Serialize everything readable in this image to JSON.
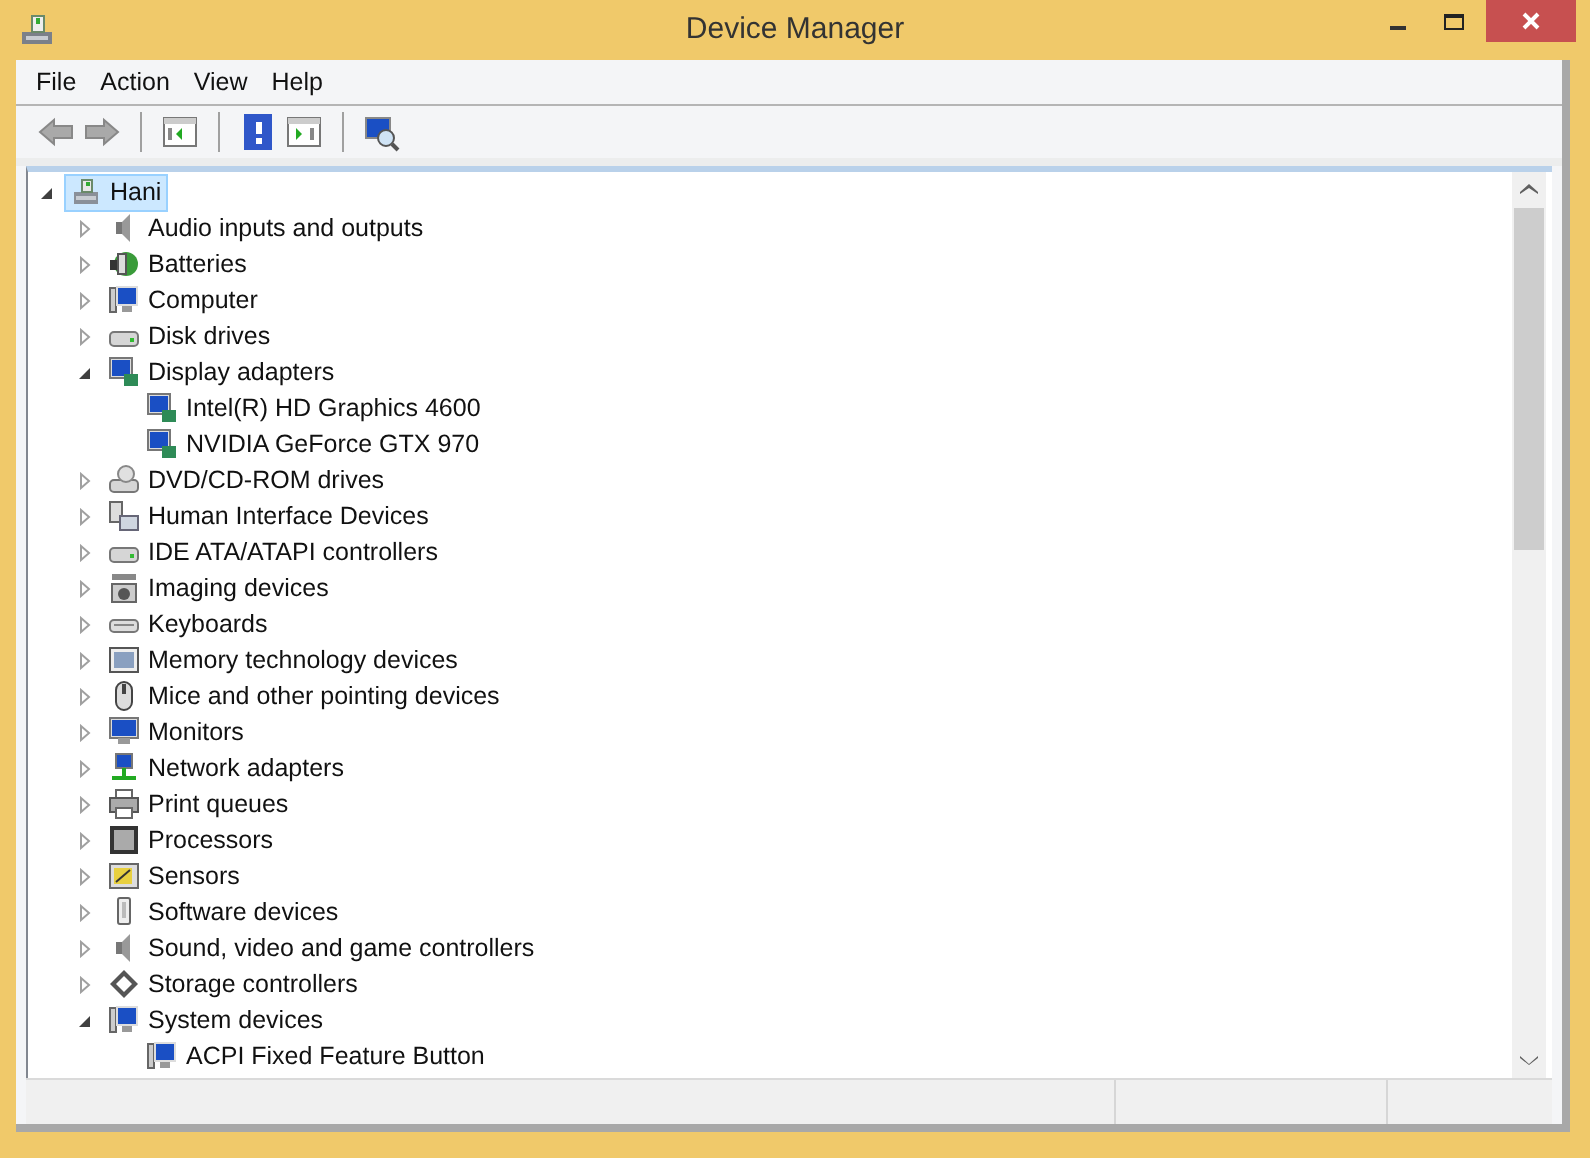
{
  "window": {
    "title": "Device Manager"
  },
  "menu": [
    "File",
    "Action",
    "View",
    "Help"
  ],
  "toolbar": [
    {
      "kind": "back"
    },
    {
      "kind": "forward"
    },
    {
      "kind": "sep"
    },
    {
      "kind": "tree"
    },
    {
      "kind": "sep"
    },
    {
      "kind": "help"
    },
    {
      "kind": "pane"
    },
    {
      "kind": "sep"
    },
    {
      "kind": "scan"
    }
  ],
  "tree": {
    "items": [
      {
        "label": "Hani",
        "kind": "host",
        "selected": true,
        "expanded": true,
        "children": [
          {
            "label": "Audio inputs and outputs",
            "kind": "speaker",
            "selected": false,
            "expanded": false
          },
          {
            "label": "Batteries",
            "kind": "battery",
            "selected": false,
            "expanded": false
          },
          {
            "label": "Computer",
            "kind": "computer",
            "selected": false,
            "expanded": false
          },
          {
            "label": "Disk drives",
            "kind": "drive",
            "selected": false,
            "expanded": false
          },
          {
            "label": "Display adapters",
            "kind": "adapter",
            "selected": false,
            "expanded": true,
            "children": [
              {
                "label": "Intel(R) HD Graphics 4600",
                "kind": "adapter",
                "selected": false
              },
              {
                "label": "NVIDIA GeForce GTX 970",
                "kind": "adapter",
                "selected": false
              }
            ]
          },
          {
            "label": "DVD/CD-ROM drives",
            "kind": "disc",
            "selected": false,
            "expanded": false
          },
          {
            "label": "Human Interface Devices",
            "kind": "hid",
            "selected": false,
            "expanded": false
          },
          {
            "label": "IDE ATA/ATAPI controllers",
            "kind": "drive",
            "selected": false,
            "expanded": false
          },
          {
            "label": "Imaging devices",
            "kind": "camera",
            "selected": false,
            "expanded": false
          },
          {
            "label": "Keyboards",
            "kind": "keyboard",
            "selected": false,
            "expanded": false
          },
          {
            "label": "Memory technology devices",
            "kind": "memory",
            "selected": false,
            "expanded": false
          },
          {
            "label": "Mice and other pointing devices",
            "kind": "mouse",
            "selected": false,
            "expanded": false
          },
          {
            "label": "Monitors",
            "kind": "monitor",
            "selected": false,
            "expanded": false
          },
          {
            "label": "Network adapters",
            "kind": "network",
            "selected": false,
            "expanded": false
          },
          {
            "label": "Print queues",
            "kind": "printer",
            "selected": false,
            "expanded": false
          },
          {
            "label": "Processors",
            "kind": "chip",
            "selected": false,
            "expanded": false
          },
          {
            "label": "Sensors",
            "kind": "sensor",
            "selected": false,
            "expanded": false
          },
          {
            "label": "Software devices",
            "kind": "software",
            "selected": false,
            "expanded": false
          },
          {
            "label": "Sound, video and game controllers",
            "kind": "speaker",
            "selected": false,
            "expanded": false
          },
          {
            "label": "Storage controllers",
            "kind": "storage",
            "selected": false,
            "expanded": false
          },
          {
            "label": "System devices",
            "kind": "computer",
            "selected": false,
            "expanded": true,
            "children": [
              {
                "label": "ACPI Fixed Feature Button",
                "kind": "computer",
                "selected": false
              }
            ]
          }
        ]
      }
    ]
  }
}
